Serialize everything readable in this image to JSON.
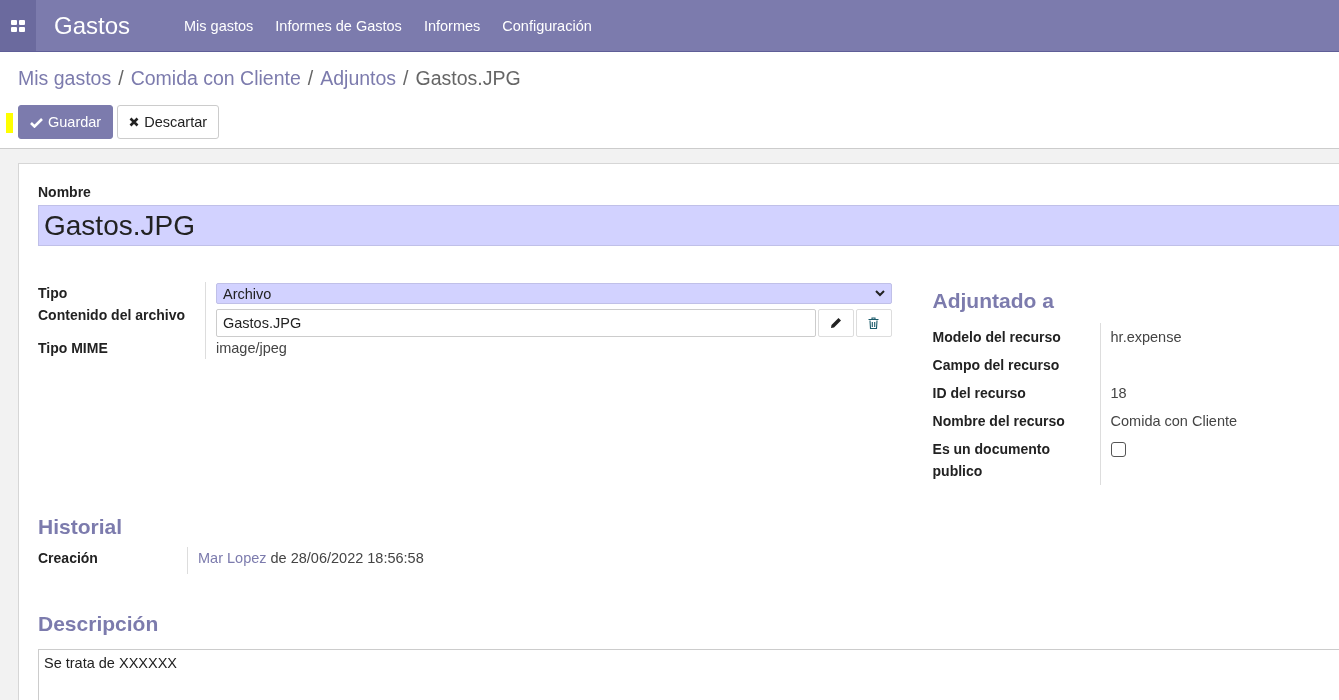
{
  "app": {
    "name": "Gastos",
    "menu": [
      "Mis gastos",
      "Informes de Gastos",
      "Informes",
      "Configuración"
    ]
  },
  "breadcrumb": [
    {
      "label": "Mis gastos",
      "link": true
    },
    {
      "separator": "/",
      "label": "Comida con Cliente",
      "link": true
    },
    {
      "separator": "/",
      "label": "Adjuntos",
      "link": true
    },
    {
      "separator": "/",
      "label": "Gastos.JPG",
      "link": false
    }
  ],
  "buttons": [
    {
      "label": "Guardar",
      "kind": "primary"
    },
    {
      "label": "Descartar",
      "kind": "secondary"
    }
  ],
  "form": {
    "name_label": "Nombre",
    "name_value": "Gastos.JPG",
    "fields": [
      {
        "label": "Tipo",
        "kind": "select",
        "value": "Archivo"
      },
      {
        "label": "Contenido del archivo",
        "kind": "file",
        "value": "Gastos.JPG"
      },
      {
        "label": "Tipo MIME",
        "kind": "text",
        "value": "image/jpeg"
      }
    ],
    "attached": {
      "title": "Adjuntado a",
      "fields": [
        {
          "label": "Modelo del recurso",
          "kind": "text",
          "value": "hr.expense"
        },
        {
          "label": "Campo del recurso",
          "kind": "text"
        },
        {
          "label": "ID del recurso",
          "kind": "text",
          "value": "18"
        },
        {
          "label": "Nombre del recurso",
          "kind": "text",
          "value": "Comida con Cliente"
        },
        {
          "label": "Es un documento publico",
          "kind": "checkbox",
          "checked": false
        }
      ]
    },
    "history": {
      "title": "Historial",
      "fields": [
        {
          "label": "Creación",
          "user": "Mar Lopez",
          "rest": "de 28/06/2022 18:56:58"
        }
      ]
    },
    "description": {
      "title": "Descripción",
      "value": "Se trata de XXXXXX"
    }
  }
}
